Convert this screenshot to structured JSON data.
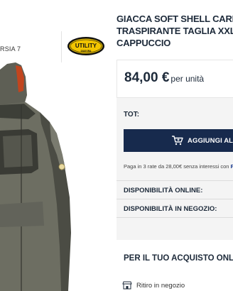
{
  "product": {
    "variant_label": "RSIA 7",
    "brand_logo_text_top": "UTILITY",
    "brand_logo_text_bottom": "DIADORA",
    "title_line1": "GIACCA SOFT SHELL CARBO",
    "title_line2": "TRASPIRANTE TAGLIA XXL A",
    "title_line3": "CAPPUCCIO"
  },
  "pricing": {
    "price": "84,00 €",
    "unit": "per unità"
  },
  "purchase": {
    "tot_label": "TOT:",
    "add_to_cart": "AGGIUNGI AL CA",
    "installments_text": "Paga in 3 rate da 28,00€ senza interessi con ",
    "installments_brand": "P"
  },
  "availability": {
    "online_label": "DISPONIBILITÀ ONLINE:",
    "store_label": "DISPONIBILITÀ IN NEGOZIO:"
  },
  "online_purchase": {
    "title": "PER IL TUO ACQUISTO ONLINE:",
    "pickup_label": "Ritiro in negozio"
  },
  "colors": {
    "accent_navy": "#172a4d",
    "logo_yellow": "#f2c500",
    "jacket_gray": "#6d6e62"
  },
  "icons": {
    "cart": "cart-icon",
    "pickup": "store-pickup-icon"
  }
}
